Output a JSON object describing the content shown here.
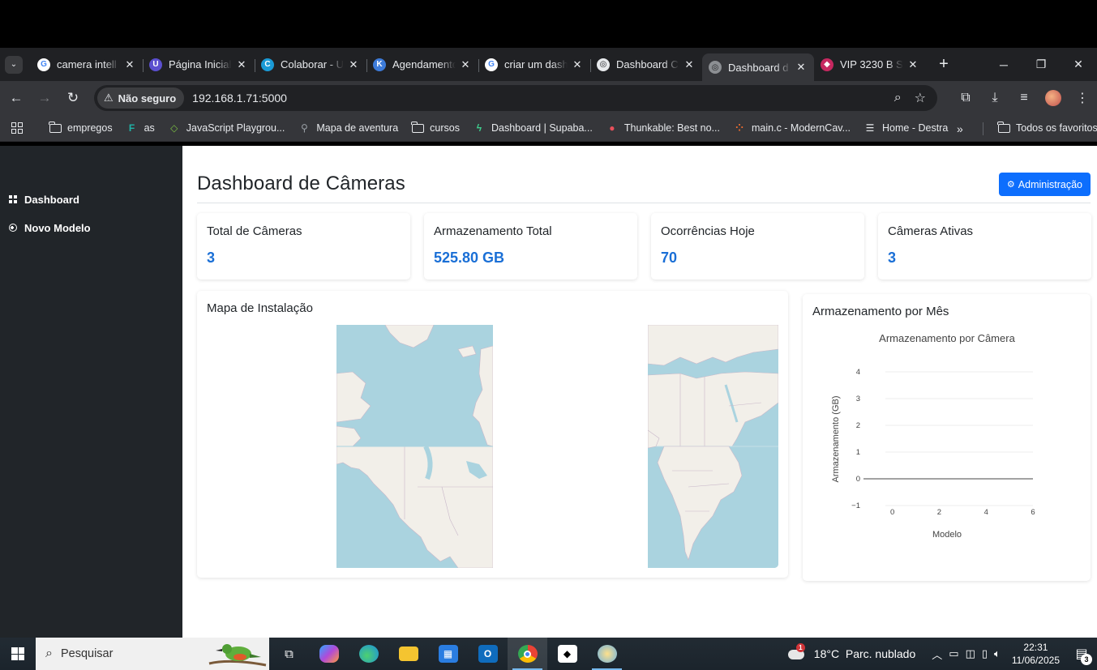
{
  "browser": {
    "tabs": [
      {
        "title": "camera intell",
        "favicon_color": "#4285f4",
        "favicon_char": "G",
        "favicon_bg": "#ffffff"
      },
      {
        "title": "Página Inicial",
        "favicon_color": "#ffffff",
        "favicon_char": "U",
        "favicon_bg": "#5b4fcf"
      },
      {
        "title": "Colaborar - U",
        "favicon_color": "#ffffff",
        "favicon_char": "C",
        "favicon_bg": "#1a9ad6"
      },
      {
        "title": "Agendamento",
        "favicon_color": "#ffffff",
        "favicon_char": "K",
        "favicon_bg": "#3d7bd9"
      },
      {
        "title": "criar um dash",
        "favicon_color": "#4285f4",
        "favicon_char": "G",
        "favicon_bg": "#ffffff"
      },
      {
        "title": "Dashboard C",
        "favicon_color": "#202124",
        "favicon_char": "◎",
        "favicon_bg": "#e8eaed"
      },
      {
        "title": "Dashboard d",
        "favicon_color": "#202124",
        "favicon_char": "◎",
        "favicon_bg": "#8c8f93",
        "active": true
      },
      {
        "title": "VIP 3230 B S",
        "favicon_color": "#ffffff",
        "favicon_char": "◆",
        "favicon_bg": "#c62860"
      }
    ],
    "omnibox": {
      "security_label": "Não seguro",
      "url": "192.168.1.71:5000"
    },
    "bookmarks": [
      {
        "label": "empregos",
        "icon": "folder-icon"
      },
      {
        "label": "as",
        "icon": "app-icon"
      },
      {
        "label": "JavaScript Playgrou...",
        "icon": "code-icon"
      },
      {
        "label": "Mapa de aventura",
        "icon": "pin-icon"
      },
      {
        "label": "cursos",
        "icon": "folder-icon"
      },
      {
        "label": "Dashboard | Supaba...",
        "icon": "bolt-icon"
      },
      {
        "label": "Thunkable: Best no...",
        "icon": "robot-icon"
      },
      {
        "label": "main.c - ModernCav...",
        "icon": "dots-icon"
      },
      {
        "label": "Home - Destra",
        "icon": "bars-icon"
      }
    ],
    "all_bookmarks": "Todos os favoritos"
  },
  "sidebar": {
    "items": [
      {
        "label": "Dashboard",
        "icon": "grid-icon"
      },
      {
        "label": "Novo Modelo",
        "icon": "plus-circle-icon"
      }
    ]
  },
  "main": {
    "title": "Dashboard de Câmeras",
    "admin_button": "Administração",
    "stats": [
      {
        "label": "Total de Câmeras",
        "value": "3"
      },
      {
        "label": "Armazenamento Total",
        "value": "525.80 GB"
      },
      {
        "label": "Ocorrências Hoje",
        "value": "70"
      },
      {
        "label": "Câmeras Ativas",
        "value": "3"
      }
    ],
    "map_title": "Mapa de Instalação",
    "chart_card_title": "Armazenamento por Mês"
  },
  "chart_data": {
    "type": "line",
    "title": "Armazenamento por Câmera",
    "xlabel": "Modelo",
    "ylabel": "Armazenamento (GB)",
    "xlim": [
      -0.3,
      6
    ],
    "ylim": [
      -1,
      4
    ],
    "xticks": [
      "0",
      "2",
      "4",
      "6"
    ],
    "xtick_values": [
      0,
      2,
      4,
      6
    ],
    "yticks": [
      "−1",
      "0",
      "1",
      "2",
      "3",
      "4"
    ],
    "ytick_values": [
      -1,
      0,
      1,
      2,
      3,
      4
    ],
    "series": [],
    "grid": true
  },
  "taskbar": {
    "search_placeholder": "Pesquisar",
    "weather": "18°C  Parc. nublado",
    "weather_badge": "1",
    "time": "22:31",
    "date": "11/06/2025",
    "notifications": "3"
  }
}
